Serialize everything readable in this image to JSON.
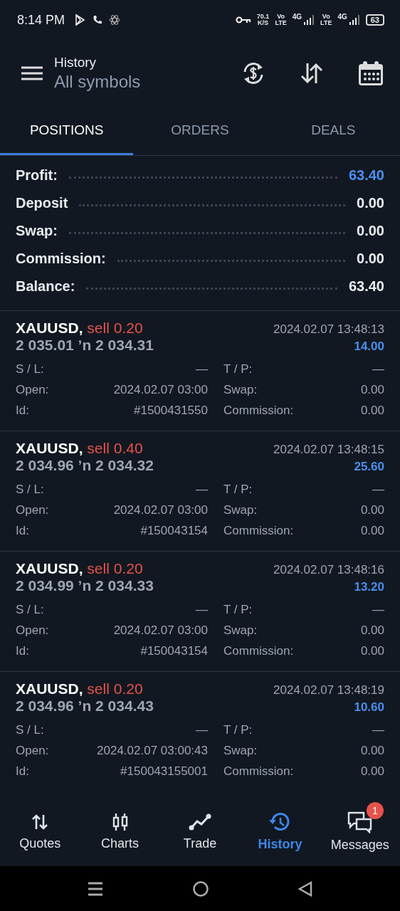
{
  "status_bar": {
    "time": "8:14 PM",
    "speed_value": "70.1",
    "speed_unit": "K/S",
    "sim1_volte": [
      "Vo",
      "LTE"
    ],
    "sim1_network": "4G",
    "sim2_volte": [
      "Vo",
      "LTE"
    ],
    "sim2_network": "4G",
    "battery": "63"
  },
  "header": {
    "title": "History",
    "subtitle": "All symbols"
  },
  "tabs": [
    {
      "label": "POSITIONS",
      "selected": true
    },
    {
      "label": "ORDERS",
      "selected": false
    },
    {
      "label": "DEALS",
      "selected": false
    }
  ],
  "summary": [
    {
      "label": "Profit:",
      "value": "63.40",
      "highlight": true
    },
    {
      "label": "Deposit",
      "value": "0.00",
      "highlight": false
    },
    {
      "label": "Swap:",
      "value": "0.00",
      "highlight": false
    },
    {
      "label": "Commission:",
      "value": "0.00",
      "highlight": false
    },
    {
      "label": "Balance:",
      "value": "63.40",
      "highlight": false
    }
  ],
  "positions": [
    {
      "symbol": "XAUUSD,",
      "side": "sell 0.20",
      "kind": "sell",
      "prices": "2 035.01 ʼn  2 034.31",
      "time": "2024.02.07 13:48:13",
      "profit": "14.00",
      "sl_label": "S / L:",
      "sl_value": "—",
      "tp_label": "T / P:",
      "tp_value": "—",
      "open_label": "Open:",
      "open_value": "2024.02.07 03:00",
      "swap_label": "Swap:",
      "swap_value": "0.00",
      "id_label": "Id:",
      "id_value": "#1500431550",
      "commission_label": "Commission:",
      "commission_value": "0.00"
    },
    {
      "symbol": "XAUUSD,",
      "side": "sell 0.40",
      "kind": "sell",
      "prices": "2 034.96 ʼn  2 034.32",
      "time": "2024.02.07 13:48:15",
      "profit": "25.60",
      "sl_label": "S / L:",
      "sl_value": "—",
      "tp_label": "T / P:",
      "tp_value": "—",
      "open_label": "Open:",
      "open_value": "2024.02.07 03:00",
      "swap_label": "Swap:",
      "swap_value": "0.00",
      "id_label": "Id:",
      "id_value": "#150043154",
      "commission_label": "Commission:",
      "commission_value": "0.00"
    },
    {
      "symbol": "XAUUSD,",
      "side": "sell 0.20",
      "kind": "sell",
      "prices": "2 034.99 ʼn  2 034.33",
      "time": "2024.02.07 13:48:16",
      "profit": "13.20",
      "sl_label": "S / L:",
      "sl_value": "—",
      "tp_label": "T / P:",
      "tp_value": "—",
      "open_label": "Open:",
      "open_value": "2024.02.07 03:00",
      "swap_label": "Swap:",
      "swap_value": "0.00",
      "id_label": "Id:",
      "id_value": "#150043154",
      "commission_label": "Commission:",
      "commission_value": "0.00"
    },
    {
      "symbol": "XAUUSD,",
      "side": "sell 0.20",
      "kind": "sell",
      "prices": "2 034.96 ʼn  2 034.43",
      "time": "2024.02.07 13:48:19",
      "profit": "10.60",
      "sl_label": "S / L:",
      "sl_value": "—",
      "tp_label": "T / P:",
      "tp_value": "—",
      "open_label": "Open:",
      "open_value": "2024.02.07 03:00:43",
      "swap_label": "Swap:",
      "swap_value": "0.00",
      "id_label": "Id:",
      "id_value": "#150043155001",
      "commission_label": "Commission:",
      "commission_value": "0.00"
    }
  ],
  "bottom_nav": [
    {
      "label": "Quotes",
      "kind": "quotes",
      "selected": false
    },
    {
      "label": "Charts",
      "kind": "charts",
      "selected": false
    },
    {
      "label": "Trade",
      "kind": "trade",
      "selected": false
    },
    {
      "label": "History",
      "kind": "history",
      "selected": true
    },
    {
      "label": "Messages",
      "kind": "messages",
      "selected": false,
      "badge": "1"
    }
  ]
}
